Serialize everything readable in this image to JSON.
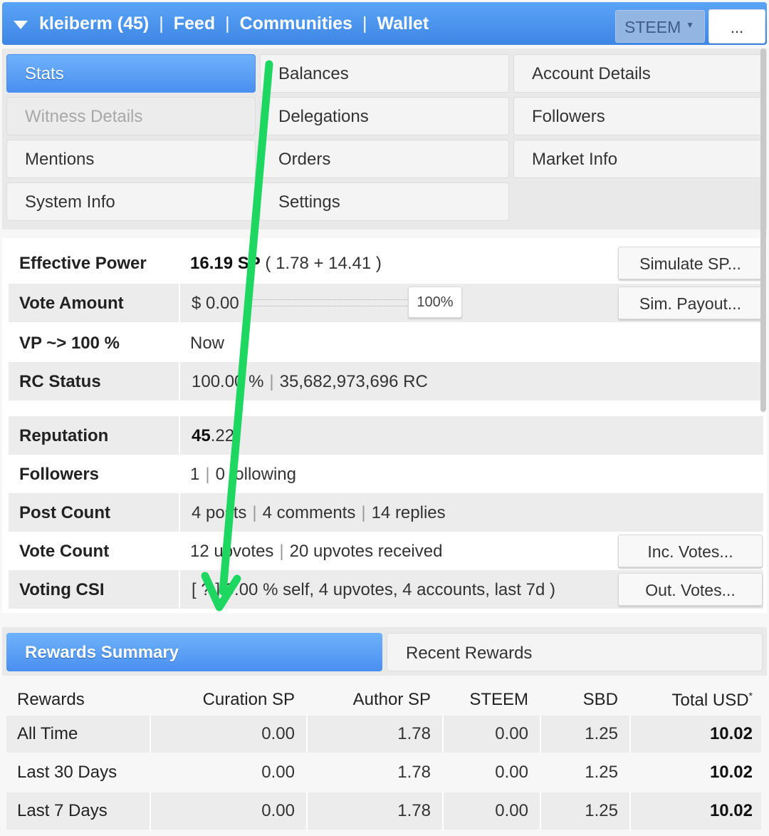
{
  "topbar": {
    "account": "kleiberm (45)",
    "feed": "Feed",
    "communities": "Communities",
    "wallet": "Wallet",
    "sep": "|",
    "currency": "STEEM",
    "caret": "▼",
    "more": "..."
  },
  "menu": {
    "stats": "Stats",
    "balances": "Balances",
    "account_details": "Account Details",
    "witness_details": "Witness Details",
    "delegations": "Delegations",
    "followers": "Followers",
    "mentions": "Mentions",
    "orders": "Orders",
    "market_info": "Market Info",
    "system_info": "System Info",
    "settings": "Settings"
  },
  "stats": {
    "effective_power": {
      "label": "Effective Power",
      "value_bold": "16.19 SP",
      "value_rest": " ( 1.78 + 14.41 )",
      "button": "Simulate SP..."
    },
    "vote_amount": {
      "label": "Vote Amount",
      "value": "$ 0.00",
      "pct": "100%",
      "button": "Sim. Payout..."
    },
    "vp": {
      "label": "VP ~> 100 %",
      "value": "Now"
    },
    "rc": {
      "label": "RC Status",
      "pct": "100.00 %",
      "rc": "35,682,973,696 RC"
    },
    "reputation": {
      "label": "Reputation",
      "value_bold": "45",
      "value_rest": ".22"
    },
    "followers": {
      "label": "Followers",
      "a": "1",
      "b": "0 following"
    },
    "post_count": {
      "label": "Post Count",
      "a": "4 posts",
      "b": "4 comments",
      "c": "14 replies"
    },
    "vote_count": {
      "label": "Vote Count",
      "a": "12 upvotes",
      "b": "20 upvotes received",
      "button": "Inc. Votes..."
    },
    "voting_csi": {
      "label": "Voting CSI",
      "value": "[ ? ] 0.00 % self, 4 upvotes, 4 accounts, last 7d )",
      "button": "Out. Votes..."
    }
  },
  "rewards_tabs": {
    "summary": "Rewards Summary",
    "recent": "Recent Rewards"
  },
  "rewards_table": {
    "headers": [
      "Rewards",
      "Curation SP",
      "Author SP",
      "STEEM",
      "SBD",
      "Total USD"
    ],
    "header_star": "*",
    "rows": [
      [
        "All Time",
        "0.00",
        "1.78",
        "0.00",
        "1.25",
        "10.02"
      ],
      [
        "Last 30 Days",
        "0.00",
        "1.78",
        "0.00",
        "1.25",
        "10.02"
      ],
      [
        "Last 7 Days",
        "0.00",
        "1.78",
        "0.00",
        "1.25",
        "10.02"
      ]
    ]
  },
  "colors": {
    "accent": "#4a8ff0",
    "arrow": "#1ed760"
  }
}
